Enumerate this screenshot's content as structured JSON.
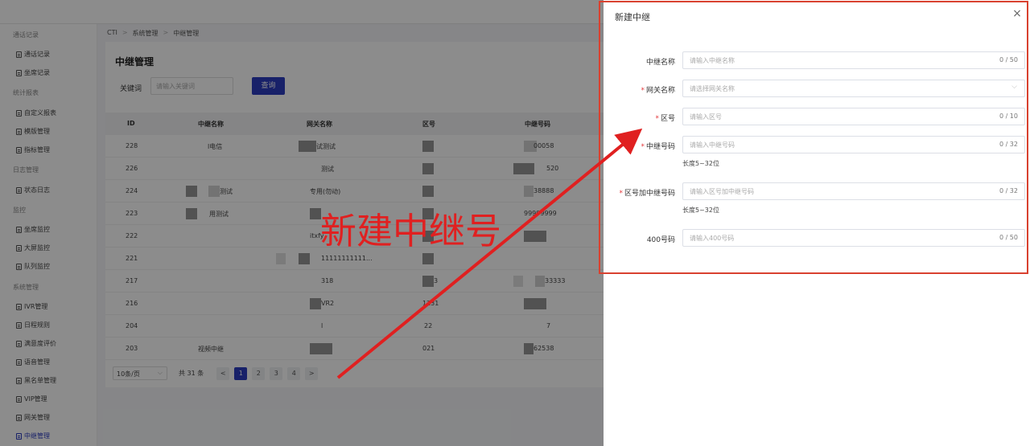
{
  "sidebar": {
    "groups": [
      {
        "label": "通话记录",
        "items": [
          "通话记录",
          "坐席记录"
        ]
      },
      {
        "label": "统计报表",
        "items": [
          "自定义报表",
          "模版管理",
          "指标管理"
        ]
      },
      {
        "label": "日志管理",
        "items": [
          "状态日志"
        ]
      },
      {
        "label": "监控",
        "items": [
          "坐席监控",
          "大屏监控",
          "队列监控"
        ]
      },
      {
        "label": "系统管理",
        "items": [
          "IVR管理",
          "日程规则",
          "满意度评价",
          "语音管理",
          "黑名单管理",
          "VIP管理",
          "网关管理",
          "中继管理"
        ]
      }
    ],
    "active_item": "中继管理"
  },
  "breadcrumb": [
    "CTI",
    "系统管理",
    "中继管理"
  ],
  "page": {
    "title": "中继管理",
    "keyword_label": "关键词",
    "keyword_placeholder": "请输入关键词",
    "query_button": "查询"
  },
  "table": {
    "columns": [
      "ID",
      "中继名称",
      "网关名称",
      "区号",
      "中继号码"
    ],
    "rows": [
      {
        "id": "228",
        "name": "l电信",
        "gateway": "试测试",
        "area": "",
        "number": "00058"
      },
      {
        "id": "226",
        "name": "",
        "gateway": "测试",
        "area": "",
        "number": "520"
      },
      {
        "id": "224",
        "name": "测试",
        "gateway": "专用(勿动)",
        "area": "",
        "number": "38888"
      },
      {
        "id": "223",
        "name": "用测试",
        "gateway": "",
        "area": "",
        "number": "99999999"
      },
      {
        "id": "222",
        "name": "",
        "gateway": "itxfy",
        "area": "",
        "number": ""
      },
      {
        "id": "221",
        "name": "",
        "gateway": "11111111111...",
        "area": "",
        "number": ""
      },
      {
        "id": "217",
        "name": "",
        "gateway": "318",
        "area": "3",
        "number": "33333"
      },
      {
        "id": "216",
        "name": "",
        "gateway": "VR2",
        "area": "1231",
        "number": ""
      },
      {
        "id": "204",
        "name": "",
        "gateway": "l",
        "area": "22",
        "number": "7"
      },
      {
        "id": "203",
        "name": "视频中继",
        "gateway": "",
        "area": "021",
        "number": "62538"
      }
    ]
  },
  "pagination": {
    "page_size": "10条/页",
    "total": "共 31 条",
    "prev": "<",
    "pages": [
      "1",
      "2",
      "3",
      "4"
    ],
    "current": "1",
    "next": ">"
  },
  "drawer": {
    "title": "新建中继",
    "close": "×",
    "fields": [
      {
        "label": "中继名称",
        "required": false,
        "placeholder": "请输入中继名称",
        "count": "0 / 50",
        "hint": ""
      },
      {
        "label": "网关名称",
        "required": true,
        "placeholder": "请选择网关名称",
        "count": "",
        "hint": "",
        "select": true
      },
      {
        "label": "区号",
        "required": true,
        "placeholder": "请输入区号",
        "count": "0 / 10",
        "hint": ""
      },
      {
        "label": "中继号码",
        "required": true,
        "placeholder": "请输入中继号码",
        "count": "0 / 32",
        "hint": "长度5~32位"
      },
      {
        "label": "区号加中继号码",
        "required": true,
        "placeholder": "请输入区号加中继号码",
        "count": "0 / 32",
        "hint": "长度5~32位"
      },
      {
        "label": "400号码",
        "required": false,
        "placeholder": "请输入400号码",
        "count": "0 / 50",
        "hint": ""
      }
    ]
  },
  "annotation": {
    "text": "新建中继号",
    "color": "#e02020"
  },
  "colors": {
    "primary": "#2d3cbf",
    "highlight_border": "#d9412f",
    "required_mark": "#e4393c"
  }
}
